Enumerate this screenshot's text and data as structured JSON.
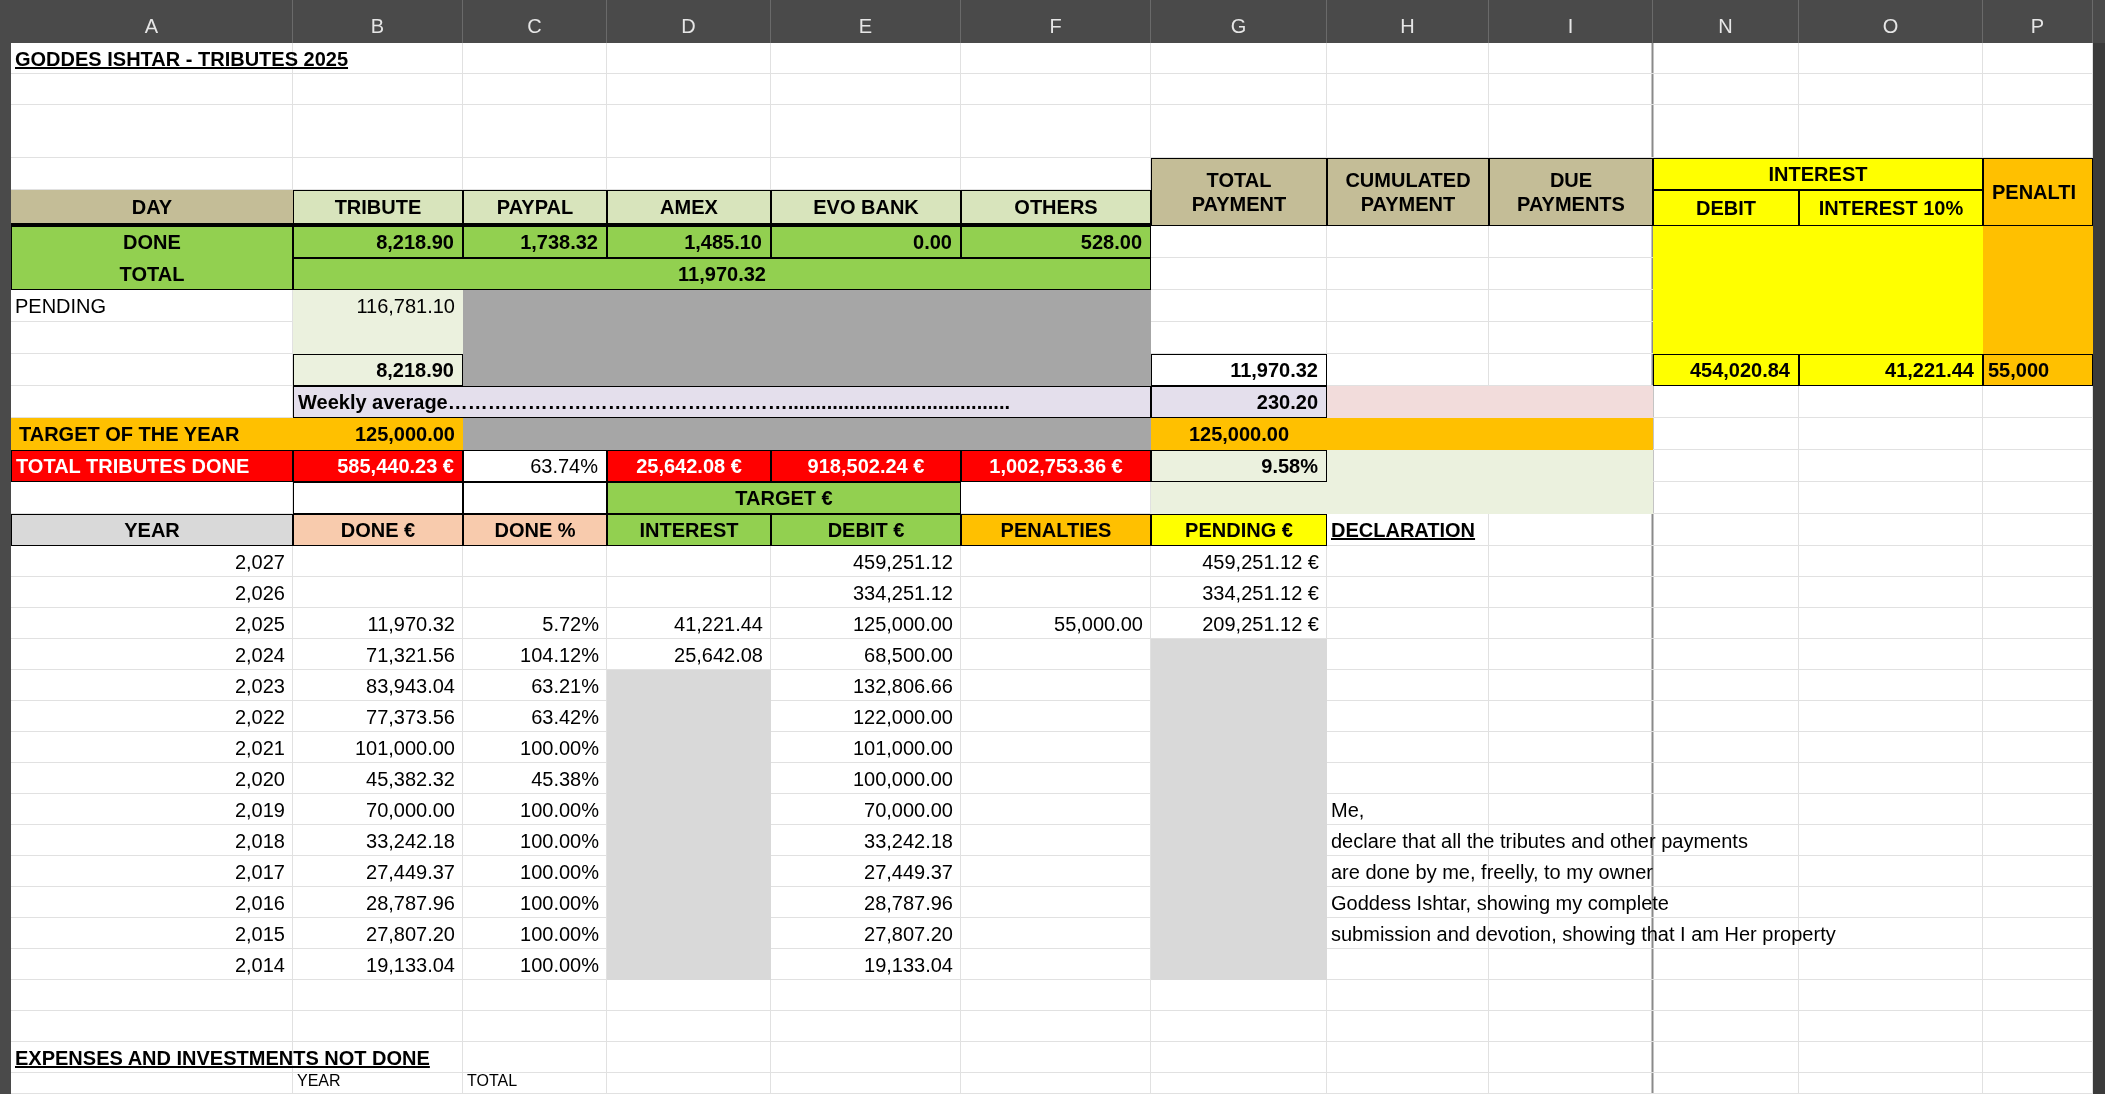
{
  "column_headers": [
    "A",
    "B",
    "C",
    "D",
    "E",
    "F",
    "G",
    "H",
    "I",
    "N",
    "O",
    "P"
  ],
  "title": "GODDES ISHTAR - TRIBUTES 2025",
  "payment_headers": {
    "day": "DAY",
    "tribute": "TRIBUTE",
    "paypal": "PAYPAL",
    "amex": "AMEX",
    "evo_bank": "EVO BANK",
    "others": "OTHERS",
    "total_payment": "TOTAL\nPAYMENT",
    "cumulated_payment": "CUMULATED\nPAYMENT",
    "due_payments": "DUE\nPAYMENTS",
    "interest": "INTEREST",
    "debit": "DEBIT",
    "interest_10": "INTEREST 10%",
    "penalties": "PENALTI"
  },
  "done_row": {
    "label": "DONE",
    "tribute": "8,218.90",
    "paypal": "1,738.32",
    "amex": "1,485.10",
    "evo_bank": "0.00",
    "others": "528.00"
  },
  "total_row": {
    "label": "TOTAL",
    "value": "11,970.32"
  },
  "pending_row": {
    "label": "PENDING",
    "value": "116,781.10"
  },
  "subtotals": {
    "tribute": "8,218.90",
    "total_payment": "11,970.32",
    "debit": "454,020.84",
    "interest": "41,221.44",
    "penalties": "55,000"
  },
  "weekly": {
    "label": "Weekly average……………………………………………........................................",
    "value": "230.20"
  },
  "target": {
    "label": "TARGET OF THE YEAR",
    "value": "125,000.00",
    "total": "125,000.00"
  },
  "totals": {
    "label": "TOTAL TRIBUTES DONE",
    "done": "585,440.23 €",
    "percent": "63.74%",
    "interest": "25,642.08 €",
    "debit": "918,502.24 €",
    "pending": "1,002,753.36 €",
    "ratio": "9.58%"
  },
  "target_header": "TARGET €",
  "year_columns": [
    "YEAR",
    "DONE €",
    "DONE %",
    "INTEREST",
    "DEBIT €",
    "PENALTIES",
    "PENDING €"
  ],
  "years": [
    {
      "year": "2,027",
      "debit": "459,251.12",
      "pending": "459,251.12 €"
    },
    {
      "year": "2,026",
      "debit": "334,251.12",
      "pending": "334,251.12 €"
    },
    {
      "year": "2,025",
      "done": "11,970.32",
      "percent": "5.72%",
      "interest": "41,221.44",
      "debit": "125,000.00",
      "penalties": "55,000.00",
      "pending": "209,251.12 €"
    },
    {
      "year": "2,024",
      "done": "71,321.56",
      "percent": "104.12%",
      "interest": "25,642.08",
      "debit": "68,500.00"
    },
    {
      "year": "2,023",
      "done": "83,943.04",
      "percent": "63.21%",
      "debit": "132,806.66"
    },
    {
      "year": "2,022",
      "done": "77,373.56",
      "percent": "63.42%",
      "debit": "122,000.00"
    },
    {
      "year": "2,021",
      "done": "101,000.00",
      "percent": "100.00%",
      "debit": "101,000.00"
    },
    {
      "year": "2,020",
      "done": "45,382.32",
      "percent": "45.38%",
      "debit": "100,000.00"
    },
    {
      "year": "2,019",
      "done": "70,000.00",
      "percent": "100.00%",
      "debit": "70,000.00"
    },
    {
      "year": "2,018",
      "done": "33,242.18",
      "percent": "100.00%",
      "debit": "33,242.18"
    },
    {
      "year": "2,017",
      "done": "27,449.37",
      "percent": "100.00%",
      "debit": "27,449.37"
    },
    {
      "year": "2,016",
      "done": "28,787.96",
      "percent": "100.00%",
      "debit": "28,787.96"
    },
    {
      "year": "2,015",
      "done": "27,807.20",
      "percent": "100.00%",
      "debit": "27,807.20"
    },
    {
      "year": "2,014",
      "done": "19,133.04",
      "percent": "100.00%",
      "debit": "19,133.04"
    }
  ],
  "declaration": {
    "title": "DECLARATION",
    "lines": [
      "Me,",
      "declare that all the tributes and other payments",
      "are done by me, freelly, to my owner",
      "Goddess Ishtar, showing my complete",
      "submission and devotion, showing that I am Her property"
    ]
  },
  "expenses": {
    "title": "EXPENSES AND INVESTMENTS NOT DONE",
    "columns": [
      "YEAR",
      "TOTAL"
    ]
  }
}
